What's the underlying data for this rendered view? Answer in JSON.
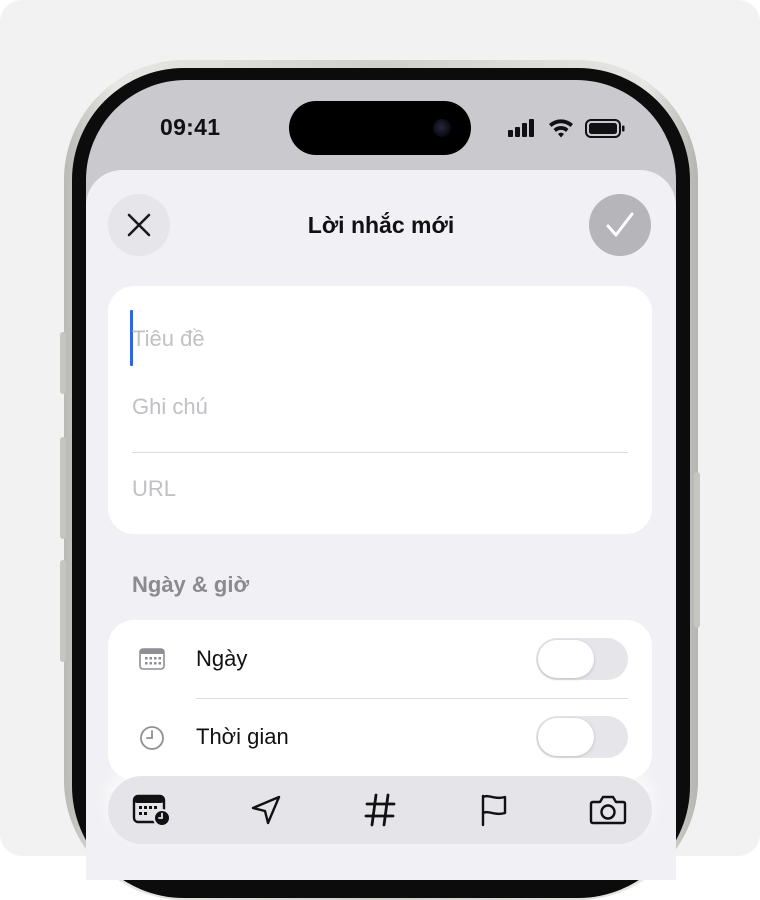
{
  "status_bar": {
    "time": "09:41"
  },
  "sheet": {
    "title": "Lời nhắc mới",
    "close_icon": "close-icon",
    "done_icon": "checkmark-icon"
  },
  "fields": {
    "title_placeholder": "Tiêu đề",
    "notes_placeholder": "Ghi chú",
    "url_placeholder": "URL"
  },
  "date_time": {
    "section_title": "Ngày & giờ",
    "date_label": "Ngày",
    "time_label": "Thời gian",
    "date_toggle_on": false,
    "time_toggle_on": false
  },
  "toolbar": {
    "items": [
      "calendar-clock-icon",
      "location-arrow-icon",
      "hashtag-icon",
      "flag-icon",
      "camera-icon"
    ]
  },
  "colors": {
    "accent_caret": "#2f63e8",
    "sheet_background": "#f1f1f5",
    "placeholder_text": "#c0c0c5"
  }
}
